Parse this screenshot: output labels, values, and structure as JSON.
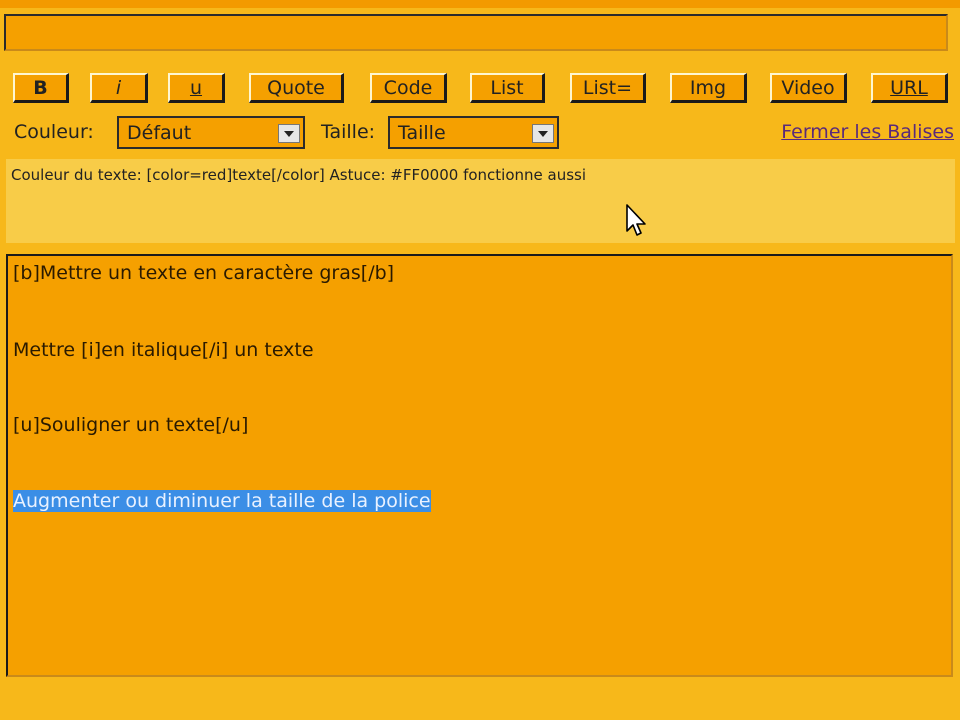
{
  "toolbar": {
    "bold": "B",
    "italic": "i",
    "underline": "u",
    "quote": "Quote",
    "code": "Code",
    "list": "List",
    "list_eq": "List=",
    "img": "Img",
    "video": "Video",
    "url": "URL"
  },
  "options": {
    "color_label": "Couleur:",
    "color_value": "Défaut",
    "size_label": "Taille:",
    "size_value": "Taille",
    "close_tags": "Fermer les Balises"
  },
  "help_text": "Couleur du texte: [color=red]texte[/color] Astuce: #FF0000 fonctionne aussi",
  "editor": {
    "lines": [
      "[b]Mettre un texte en caractère gras[/b]",
      "Mettre [i]en italique[/i] un texte",
      "[u]Souligner un texte[/u]",
      "Augmenter ou diminuer la taille de la police"
    ]
  },
  "colors": {
    "background": "#F7B81A",
    "field": "#F5A000",
    "help_panel": "#F8CC48",
    "selection": "#3B8EE6"
  }
}
